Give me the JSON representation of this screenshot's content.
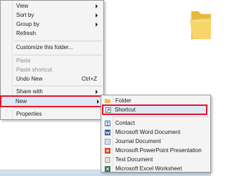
{
  "context_menu": {
    "items": [
      {
        "label": "View",
        "has_submenu": true,
        "enabled": true
      },
      {
        "label": "Sort by",
        "has_submenu": true,
        "enabled": true
      },
      {
        "label": "Group by",
        "has_submenu": true,
        "enabled": true
      },
      {
        "label": "Refresh",
        "has_submenu": false,
        "enabled": true
      },
      {
        "label": "Customize this folder...",
        "has_submenu": false,
        "enabled": true
      },
      {
        "label": "Paste",
        "has_submenu": false,
        "enabled": false
      },
      {
        "label": "Paste shortcut",
        "has_submenu": false,
        "enabled": false
      },
      {
        "label": "Undo New",
        "shortcut": "Ctrl+Z",
        "has_submenu": false,
        "enabled": true
      },
      {
        "label": "Share with",
        "has_submenu": true,
        "enabled": true
      },
      {
        "label": "New",
        "has_submenu": true,
        "enabled": true,
        "highlighted": true
      },
      {
        "label": "Properties",
        "has_submenu": false,
        "enabled": true
      }
    ]
  },
  "new_submenu": {
    "items": [
      {
        "label": "Folder",
        "icon": "folder-icon"
      },
      {
        "label": "Shortcut",
        "icon": "shortcut-icon",
        "highlighted": true
      },
      {
        "label": "Contact",
        "icon": "contact-icon"
      },
      {
        "label": "Microsoft Word Document",
        "icon": "word-document-icon"
      },
      {
        "label": "Journal Document",
        "icon": "journal-document-icon"
      },
      {
        "label": "Microsoft PowerPoint Presentation",
        "icon": "powerpoint-icon"
      },
      {
        "label": "Text Document",
        "icon": "text-document-icon"
      },
      {
        "label": "Microsoft Excel Worksheet",
        "icon": "excel-icon"
      }
    ]
  },
  "colors": {
    "highlight_border": "#e0142b",
    "menu_background": "#f4f4f4",
    "folder_yellow": "#f2c94c"
  }
}
